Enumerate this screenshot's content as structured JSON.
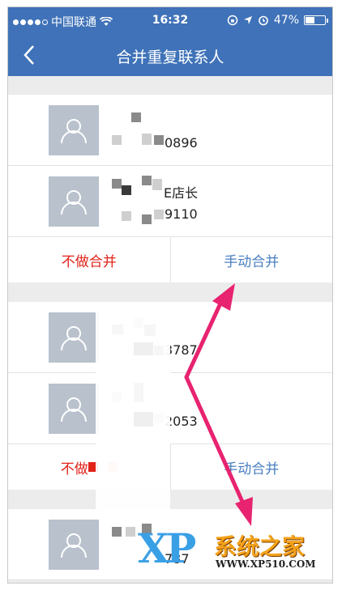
{
  "status_bar": {
    "carrier": "中国联通",
    "time": "16:32",
    "battery": "47%",
    "battery_level": 0.47
  },
  "nav": {
    "title": "合并重复联系人",
    "back_icon": "chevron-left-icon"
  },
  "groups": [
    {
      "contacts": [
        {
          "name": "",
          "phone": "0896"
        },
        {
          "name": "E店长",
          "phone": "9110"
        }
      ],
      "actions": {
        "no_merge": "不做合并",
        "manual_merge": "手动合并"
      }
    },
    {
      "contacts": [
        {
          "name": "",
          "phone": "3787"
        },
        {
          "name": "",
          "phone": "2053"
        }
      ],
      "actions": {
        "no_merge": "不做",
        "manual_merge": "手动合并"
      }
    },
    {
      "contacts": [
        {
          "name": "",
          "phone": "787"
        }
      ]
    }
  ],
  "watermark": {
    "logo": "XP",
    "brand": "系统之家",
    "url": "WWW.XP510.COM"
  },
  "colors": {
    "header_bg": "#3f72b8",
    "no_merge": "#e2231a",
    "manual_merge": "#4a7fc1",
    "arrow": "#e8236f"
  }
}
